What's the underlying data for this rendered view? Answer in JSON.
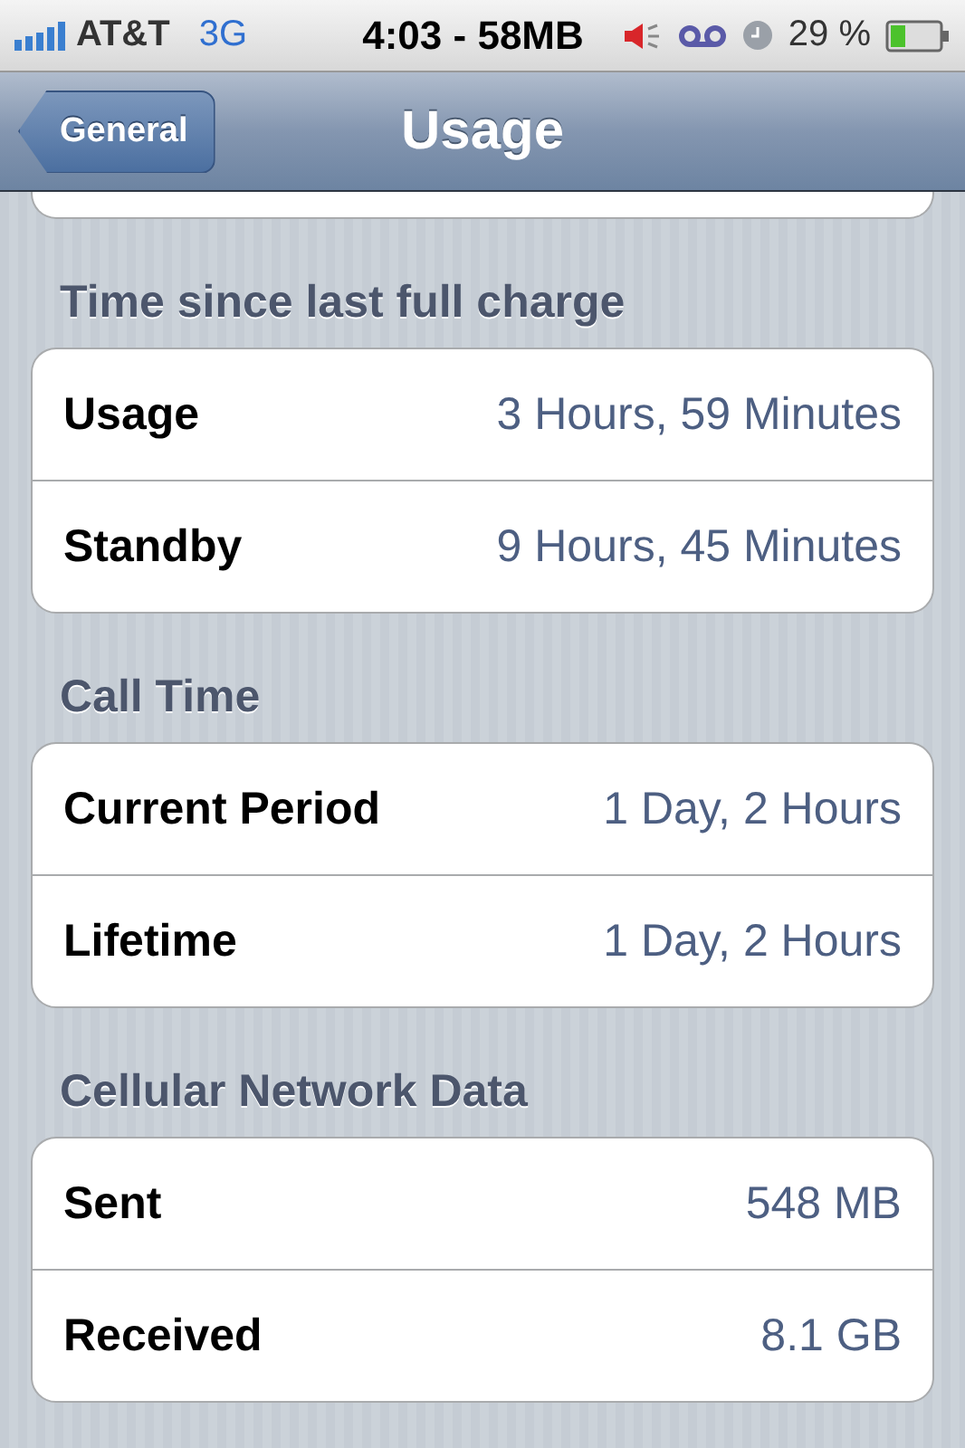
{
  "status_bar": {
    "carrier": "AT&T",
    "network": "3G",
    "time": "4:03 - 58MB",
    "battery_percent": "29 %"
  },
  "nav_bar": {
    "back_button": "General",
    "title": "Usage"
  },
  "sections": [
    {
      "header": "Time since last full charge",
      "rows": [
        {
          "label": "Usage",
          "value": "3 Hours, 59 Minutes"
        },
        {
          "label": "Standby",
          "value": "9 Hours, 45 Minutes"
        }
      ]
    },
    {
      "header": "Call Time",
      "rows": [
        {
          "label": "Current Period",
          "value": "1 Day, 2 Hours"
        },
        {
          "label": "Lifetime",
          "value": "1 Day, 2 Hours"
        }
      ]
    },
    {
      "header": "Cellular Network Data",
      "rows": [
        {
          "label": "Sent",
          "value": "548 MB"
        },
        {
          "label": "Received",
          "value": "8.1 GB"
        }
      ]
    }
  ]
}
